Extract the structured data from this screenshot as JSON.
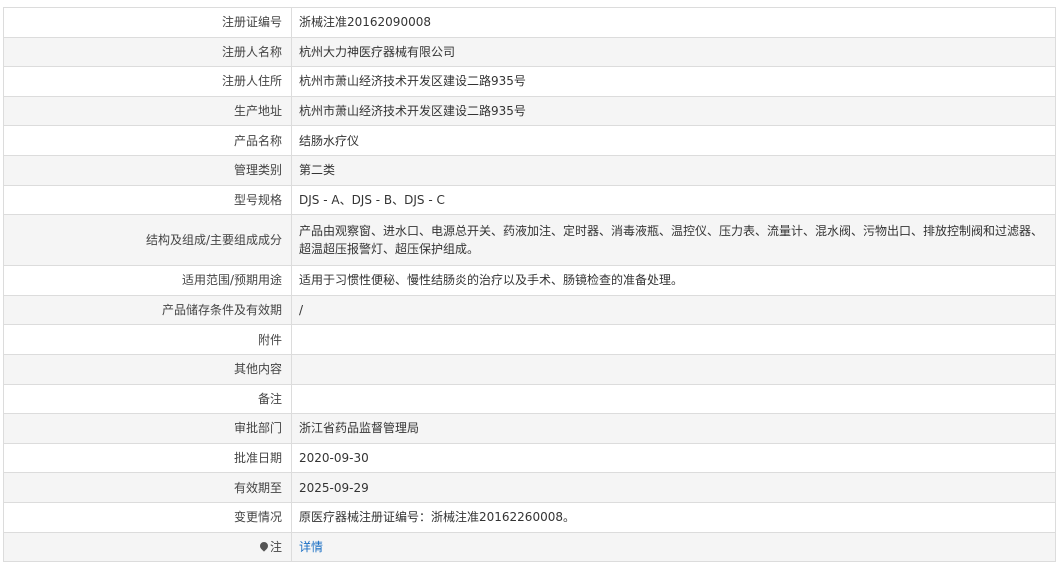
{
  "rows": [
    {
      "label": "注册证编号",
      "value": "浙械注准20162090008"
    },
    {
      "label": "注册人名称",
      "value": "杭州大力神医疗器械有限公司"
    },
    {
      "label": "注册人住所",
      "value": "杭州市萧山经济技术开发区建设二路935号"
    },
    {
      "label": "生产地址",
      "value": "杭州市萧山经济技术开发区建设二路935号"
    },
    {
      "label": "产品名称",
      "value": "结肠水疗仪"
    },
    {
      "label": "管理类别",
      "value": "第二类"
    },
    {
      "label": "型号规格",
      "value": "DJS - A、DJS - B、DJS - C"
    },
    {
      "label": "结构及组成/主要组成成分",
      "value": "产品由观察窗、进水口、电源总开关、药液加注、定时器、消毒液瓶、温控仪、压力表、流量计、混水阀、污物出口、排放控制阀和过滤器、超温超压报警灯、超压保护组成。"
    },
    {
      "label": "适用范围/预期用途",
      "value": "适用于习惯性便秘、慢性结肠炎的治疗以及手术、肠镜检查的准备处理。"
    },
    {
      "label": "产品储存条件及有效期",
      "value": "/"
    },
    {
      "label": "附件",
      "value": ""
    },
    {
      "label": "其他内容",
      "value": ""
    },
    {
      "label": "备注",
      "value": ""
    },
    {
      "label": "审批部门",
      "value": "浙江省药品监督管理局"
    },
    {
      "label": "批准日期",
      "value": "2020-09-30"
    },
    {
      "label": "有效期至",
      "value": "2025-09-29"
    },
    {
      "label": "变更情况",
      "value": "原医疗器械注册证编号：浙械注准20162260008。"
    }
  ],
  "note": {
    "icon": "pin-icon",
    "label": "注",
    "link_text": "详情"
  }
}
